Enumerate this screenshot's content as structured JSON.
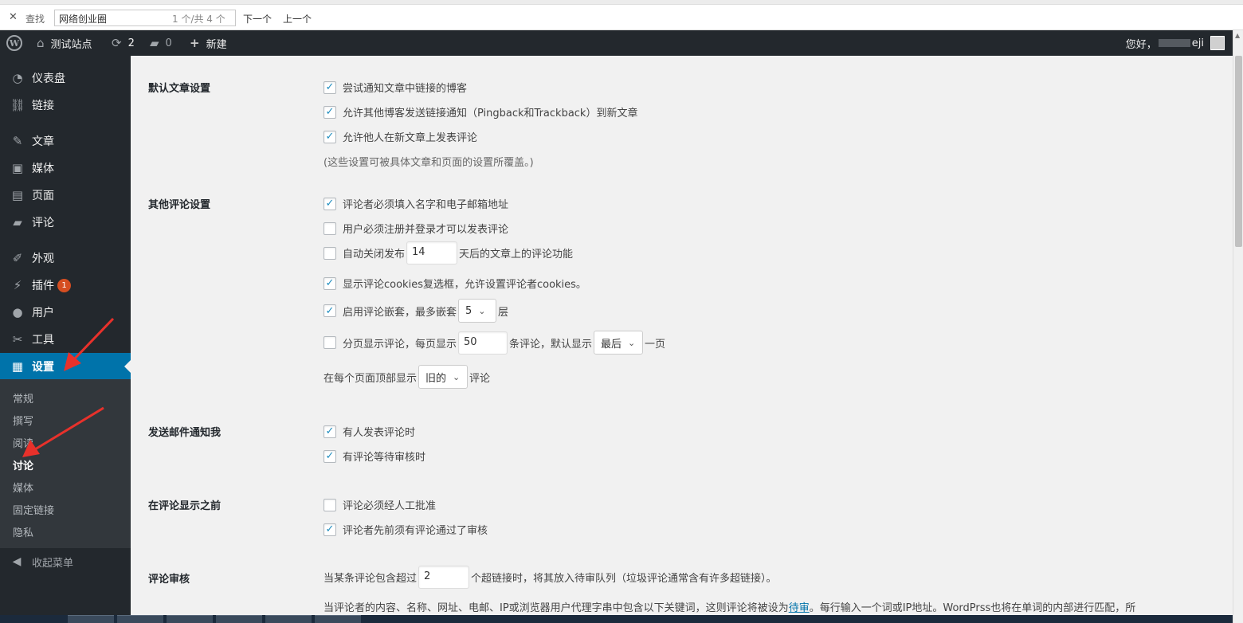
{
  "findbar": {
    "close": "✕",
    "label": "查找",
    "query": "网络创业圈",
    "count": "1 个/共 4 个",
    "next": "下一个",
    "prev": "上一个"
  },
  "adminbar": {
    "site": "测试站点",
    "updates": "2",
    "comments": "0",
    "new": "新建",
    "greeting": "您好，",
    "username_suffix": "eji"
  },
  "sidebar": {
    "items": [
      {
        "label": "仪表盘",
        "icon": "dashboard-icon"
      },
      {
        "label": "链接",
        "icon": "link-icon"
      },
      {
        "label": "文章",
        "icon": "pin-icon"
      },
      {
        "label": "媒体",
        "icon": "media-icon"
      },
      {
        "label": "页面",
        "icon": "page-icon"
      },
      {
        "label": "评论",
        "icon": "comment-icon"
      },
      {
        "label": "外观",
        "icon": "brush-icon"
      },
      {
        "label": "插件",
        "icon": "plugin-icon",
        "badge": "1"
      },
      {
        "label": "用户",
        "icon": "user-icon"
      },
      {
        "label": "工具",
        "icon": "wrench-icon"
      },
      {
        "label": "设置",
        "icon": "settings-icon"
      }
    ],
    "submenu": [
      "常规",
      "撰写",
      "阅读",
      "讨论",
      "媒体",
      "固定链接",
      "隐私"
    ],
    "collapse": "收起菜单"
  },
  "settings": {
    "default_article": {
      "heading": "默认文章设置",
      "opt1": "尝试通知文章中链接的博客",
      "opt2": "允许其他博客发送链接通知（Pingback和Trackback）到新文章",
      "opt3": "允许他人在新文章上发表评论",
      "note": "(这些设置可被具体文章和页面的设置所覆盖。)"
    },
    "other_comment": {
      "heading": "其他评论设置",
      "opt1": "评论者必须填入名字和电子邮箱地址",
      "opt2": "用户必须注册并登录才可以发表评论",
      "opt3_pre": "自动关闭发布",
      "opt3_value": "14",
      "opt3_post": "天后的文章上的评论功能",
      "opt4": "显示评论cookies复选框，允许设置评论者cookies。",
      "opt5_pre": "启用评论嵌套，最多嵌套",
      "opt5_value": "5",
      "opt5_post": "层",
      "opt6_pre": "分页显示评论，每页显示",
      "opt6_value": "50",
      "opt6_mid": "条评论，默认显示",
      "opt6_select": "最后",
      "opt6_post": "一页",
      "opt7_pre": "在每个页面顶部显示",
      "opt7_select": "旧的",
      "opt7_post": "评论"
    },
    "email_me": {
      "heading": "发送邮件通知我",
      "opt1": "有人发表评论时",
      "opt2": "有评论等待审核时"
    },
    "before_appear": {
      "heading": "在评论显示之前",
      "opt1": "评论必须经人工批准",
      "opt2": "评论者先前须有评论通过了审核"
    },
    "moderation": {
      "heading": "评论审核",
      "line1_pre": "当某条评论包含超过",
      "line1_value": "2",
      "line1_post": "个超链接时，将其放入待审队列（垃圾评论通常含有许多超链接）。",
      "line2_pre": "当评论者的内容、名称、网址、电邮、IP或浏览器用户代理字串中包含以下关键词，这则评论将被设为",
      "line2_link": "待审",
      "line2_post": "。每行输入一个词或IP地址。WordPrss也将在单词的内部进行匹配，所"
    }
  },
  "colors": {
    "adminbar": "#23282d",
    "accent": "#0073aa",
    "arrow": "#e8312b"
  }
}
